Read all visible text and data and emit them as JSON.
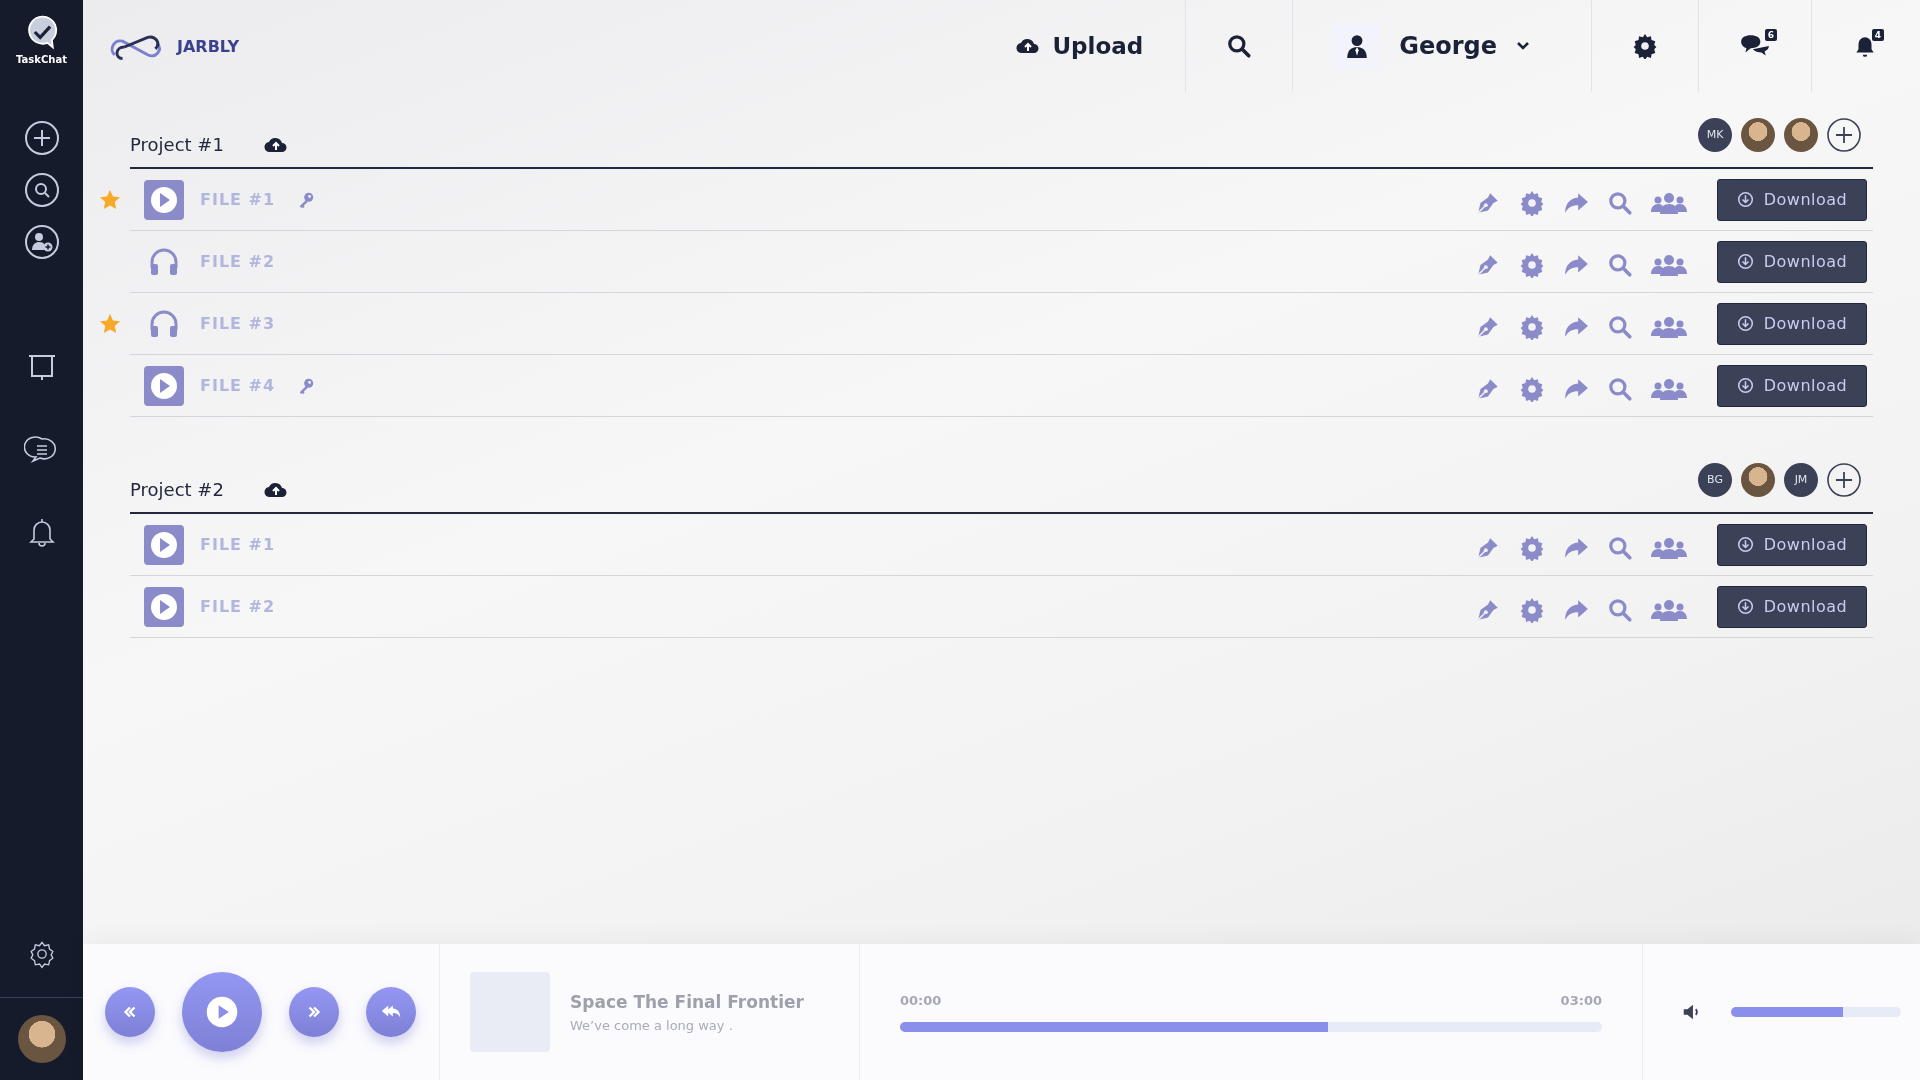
{
  "sidebar": {
    "app_name": "TaskChat"
  },
  "header": {
    "brand": "JARBLY",
    "upload": "Upload",
    "user": "George",
    "messages_badge": "6",
    "notifications_badge": "4"
  },
  "projects": [
    {
      "title": "Project #1",
      "members": [
        {
          "kind": "initials",
          "text": "MK"
        },
        {
          "kind": "photo"
        },
        {
          "kind": "photo"
        }
      ],
      "files": [
        {
          "name": "FILE #1",
          "kind": "video",
          "starred": true,
          "locked": true,
          "action": "Download"
        },
        {
          "name": "FILE #2",
          "kind": "audio",
          "starred": false,
          "locked": false,
          "action": "Download"
        },
        {
          "name": "FILE #3",
          "kind": "audio",
          "starred": true,
          "locked": false,
          "action": "Download"
        },
        {
          "name": "FILE #4",
          "kind": "video",
          "starred": false,
          "locked": true,
          "action": "Download"
        }
      ]
    },
    {
      "title": "Project #2",
      "members": [
        {
          "kind": "initials",
          "text": "BG"
        },
        {
          "kind": "photo"
        },
        {
          "kind": "initials",
          "text": "JM"
        }
      ],
      "files": [
        {
          "name": "FILE #1",
          "kind": "video",
          "starred": false,
          "locked": false,
          "action": "Download"
        },
        {
          "name": "FILE #2",
          "kind": "video",
          "starred": false,
          "locked": false,
          "action": "Download"
        }
      ]
    }
  ],
  "player": {
    "title": "Space The Final Frontier",
    "subtitle": "We’ve come a long way .",
    "elapsed": "00:00",
    "duration": "03:00",
    "progress": {
      "level": 0.61
    },
    "volume": {
      "level": 0.66
    }
  }
}
